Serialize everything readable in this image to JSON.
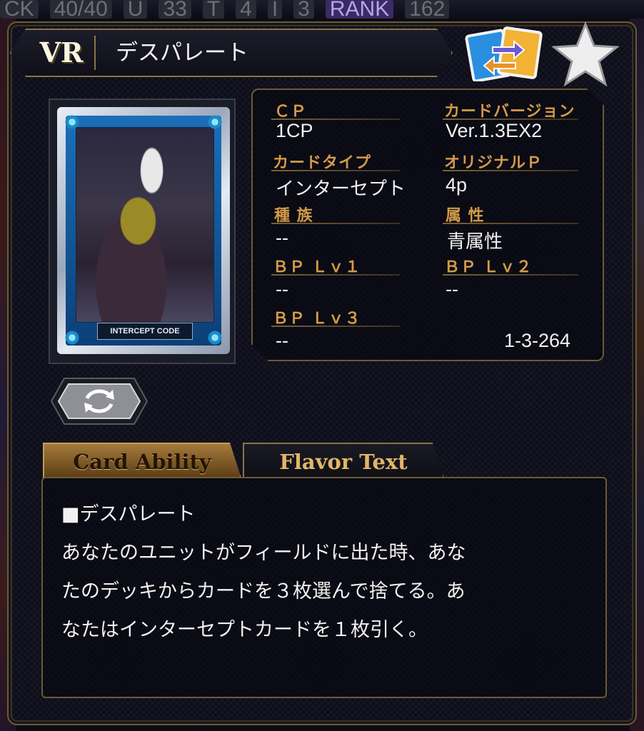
{
  "background": {
    "top_strip": [
      "CK",
      "40/40",
      "U",
      "33",
      "T",
      "4",
      "I",
      "3",
      "RANK",
      "162"
    ]
  },
  "header": {
    "rarity": "VR",
    "card_name": "デスパレート",
    "swap_icon": "swap-cards-icon",
    "favorite_icon": "star-icon"
  },
  "card_image": {
    "label": "INTERCEPT CODE"
  },
  "flip_button_icon": "rotate-icon",
  "stats": {
    "cp_label": "ＣＰ",
    "cp_value": "1CP",
    "version_label": "カードバージョン",
    "version_value": "Ver.1.3EX2",
    "type_label": "カードタイプ",
    "type_value": "インターセプト",
    "original_p_label": "オリジナルＰ",
    "original_p_value": "4p",
    "race_label": "種 族",
    "race_value": "--",
    "attribute_label": "属 性",
    "attribute_value": "青属性",
    "bp1_label": "ＢＰ Ｌｖ１",
    "bp1_value": "--",
    "bp2_label": "ＢＰ Ｌｖ２",
    "bp2_value": "--",
    "bp3_label": "ＢＰ Ｌｖ３",
    "bp3_value": "--",
    "card_number": "1-3-264"
  },
  "tabs": {
    "ability": "Card Ability",
    "flavor": "Flavor Text"
  },
  "ability": {
    "lines": [
      "■デスパレート",
      "あなたのユニットがフィールドに出た時、あな",
      "たのデッキからカードを３枚選んで捨てる。あ",
      "なたはインターセプトカードを１枚引く。"
    ]
  }
}
